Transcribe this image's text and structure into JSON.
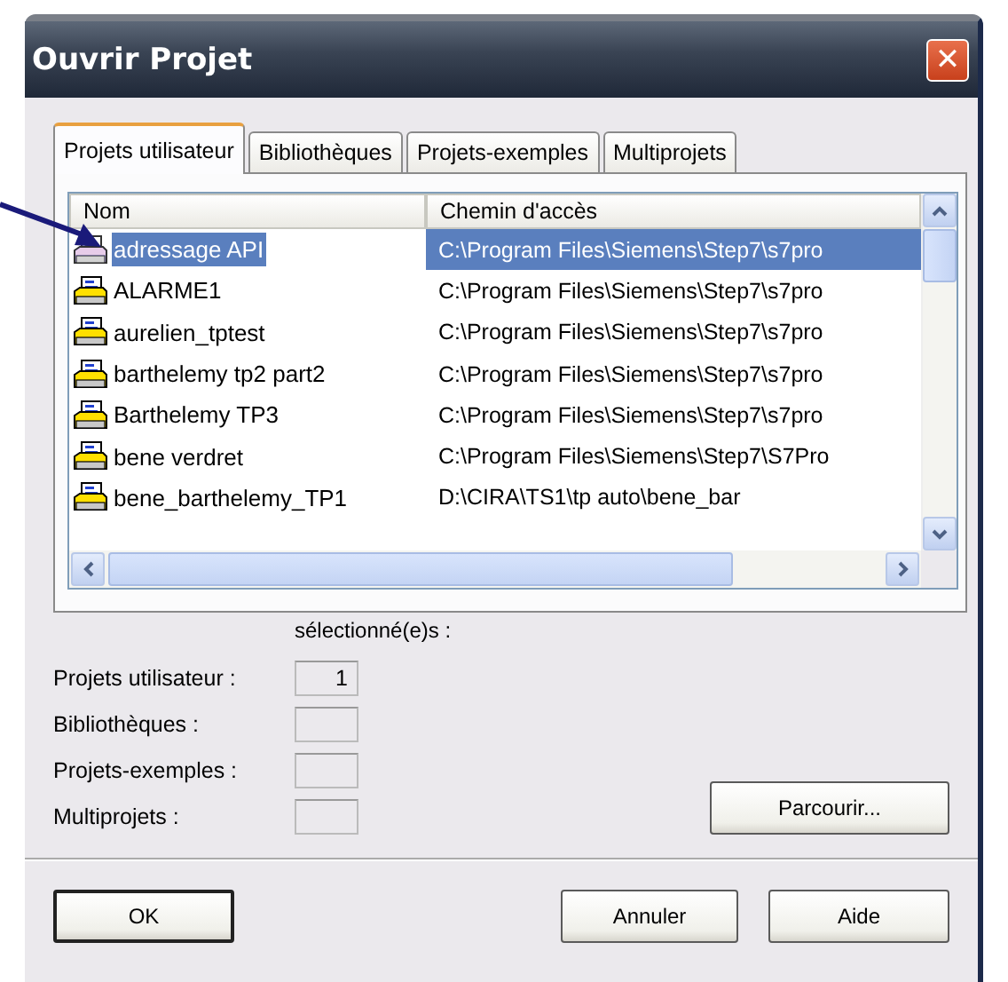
{
  "window": {
    "title": "Ouvrir Projet",
    "close": "✕"
  },
  "tabs": [
    {
      "label": "Projets utilisateur",
      "selected": true
    },
    {
      "label": "Bibliothèques",
      "selected": false
    },
    {
      "label": "Projets-exemples",
      "selected": false
    },
    {
      "label": "Multiprojets",
      "selected": false
    }
  ],
  "list": {
    "columns": [
      "Nom",
      "Chemin d'accès"
    ],
    "rows": [
      {
        "name": "adressage API",
        "path": "C:\\Program Files\\Siemens\\Step7\\s7pro",
        "selected": true
      },
      {
        "name": "ALARME1",
        "path": "C:\\Program Files\\Siemens\\Step7\\s7pro",
        "selected": false
      },
      {
        "name": "aurelien_tptest",
        "path": "C:\\Program Files\\Siemens\\Step7\\s7pro",
        "selected": false
      },
      {
        "name": "barthelemy tp2 part2",
        "path": "C:\\Program Files\\Siemens\\Step7\\s7pro",
        "selected": false
      },
      {
        "name": "Barthelemy TP3",
        "path": "C:\\Program Files\\Siemens\\Step7\\s7pro",
        "selected": false
      },
      {
        "name": "bene verdret",
        "path": "C:\\Program Files\\Siemens\\Step7\\S7Pro",
        "selected": false
      },
      {
        "name": "bene_barthelemy_TP1",
        "path": "D:\\CIRA\\TS1\\tp auto\\bene_bar",
        "selected": false
      }
    ]
  },
  "selection": {
    "heading": "sélectionné(e)s :",
    "counts": [
      {
        "label": "Projets utilisateur :",
        "value": "1"
      },
      {
        "label": "Bibliothèques :"
      },
      {
        "label": "Projets-exemples :"
      },
      {
        "label": "Multiprojets :"
      }
    ]
  },
  "browse_button": "Parcourir...",
  "buttons": [
    {
      "label": "OK",
      "default": true
    },
    {
      "label": "Annuler",
      "default": false
    },
    {
      "label": "Aide",
      "default": false
    }
  ]
}
